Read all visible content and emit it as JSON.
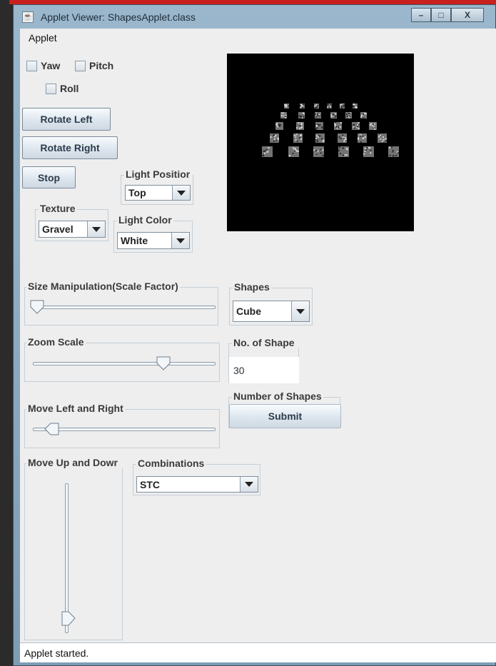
{
  "window": {
    "title": "Applet Viewer: ShapesApplet.class",
    "minimize_label": "–",
    "maximize_label": "□",
    "close_label": "X"
  },
  "menu": {
    "applet": "Applet"
  },
  "rotation": {
    "yaw": "Yaw",
    "pitch": "Pitch",
    "roll": "Roll"
  },
  "buttons": {
    "rotate_left": "Rotate Left",
    "rotate_right": "Rotate Right",
    "stop": "Stop"
  },
  "texture": {
    "legend": "Texture",
    "value": "Gravel"
  },
  "light_position": {
    "legend": "Light Positior",
    "value": "Top"
  },
  "light_color": {
    "legend": "Light Color",
    "value": "White"
  },
  "size_slider": {
    "legend": "Size Manipulation(Scale Factor)",
    "value_fraction": 0.0
  },
  "zoom_slider": {
    "legend": "Zoom Scale",
    "value_fraction": 0.75
  },
  "move_lr_slider": {
    "legend": "Move Left and Right",
    "value_fraction": 0.08
  },
  "move_ud_slider": {
    "legend": "Move Up and Dowr",
    "value_fraction": 0.05
  },
  "shapes": {
    "legend": "Shapes",
    "value": "Cube"
  },
  "shape_count": {
    "legend": "No. of Shape",
    "value": "30"
  },
  "number_of_shapes": {
    "legend": "Number of Shapes",
    "submit_label": "Submit"
  },
  "combinations": {
    "legend": "Combinations",
    "value": "STC"
  },
  "status": {
    "text": "Applet started."
  },
  "colors": {
    "canvas_bg": "#000000",
    "cube": "#9a9a9a",
    "titlebar": "#8faac0"
  }
}
